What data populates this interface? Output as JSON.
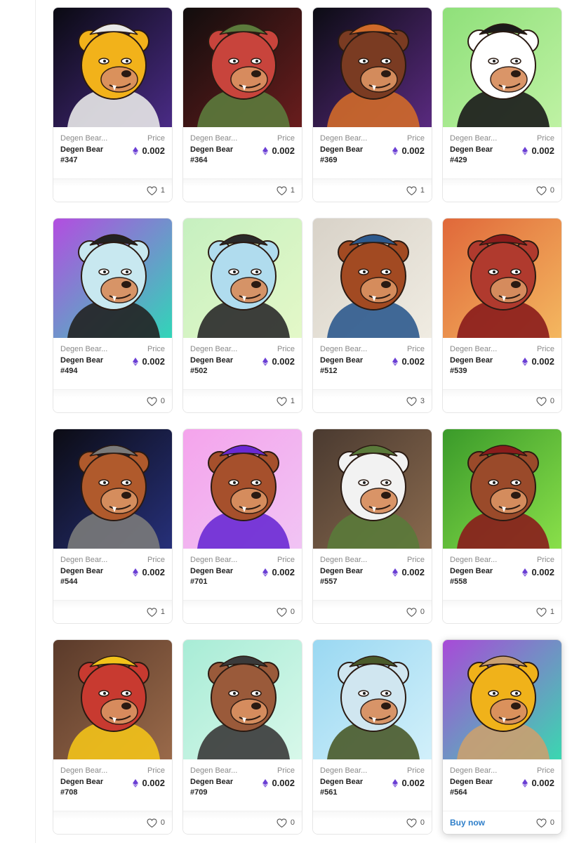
{
  "labels": {
    "price": "Price",
    "buy_now": "Buy now"
  },
  "colors": {
    "eth": "#6b3fd4",
    "link": "#2d7ec9"
  },
  "cards": [
    {
      "collection": "Degen Bear...",
      "name": "Degen Bear",
      "number": "#347",
      "price": "0.002",
      "likes": "1",
      "bg": [
        "#0a0a12",
        "#4a2b86"
      ],
      "fur": "#f2b21a",
      "accent": "#e8e8e8"
    },
    {
      "collection": "Degen Bear...",
      "name": "Degen Bear",
      "number": "#364",
      "price": "0.002",
      "likes": "1",
      "bg": [
        "#110d0d",
        "#6a1d1d"
      ],
      "fur": "#c8443c",
      "accent": "#5c7a3c"
    },
    {
      "collection": "Degen Bear...",
      "name": "Degen Bear",
      "number": "#369",
      "price": "0.002",
      "likes": "1",
      "bg": [
        "#0c0c14",
        "#5a2a80"
      ],
      "fur": "#7a3b22",
      "accent": "#d06a2a"
    },
    {
      "collection": "Degen Bear...",
      "name": "Degen Bear",
      "number": "#429",
      "price": "0.002",
      "likes": "0",
      "bg": [
        "#8fe07a",
        "#bff2a4"
      ],
      "fur": "#ffffff",
      "accent": "#1a1a1a"
    },
    {
      "collection": "Degen Bear...",
      "name": "Degen Bear",
      "number": "#494",
      "price": "0.002",
      "likes": "0",
      "bg": [
        "#b34de0",
        "#30d6b8"
      ],
      "fur": "#c8e8f0",
      "accent": "#222222"
    },
    {
      "collection": "Degen Bear...",
      "name": "Degen Bear",
      "number": "#502",
      "price": "0.002",
      "likes": "1",
      "bg": [
        "#c6f0c0",
        "#e4f8c8"
      ],
      "fur": "#b0dcee",
      "accent": "#2a2a2a"
    },
    {
      "collection": "Degen Bear...",
      "name": "Degen Bear",
      "number": "#512",
      "price": "0.002",
      "likes": "3",
      "bg": [
        "#d8d2c8",
        "#f0ece2"
      ],
      "fur": "#a24a22",
      "accent": "#2d5a8e"
    },
    {
      "collection": "Degen Bear...",
      "name": "Degen Bear",
      "number": "#539",
      "price": "0.002",
      "likes": "0",
      "bg": [
        "#e0683a",
        "#f4b860"
      ],
      "fur": "#b03a2e",
      "accent": "#8a1c1c"
    },
    {
      "collection": "Degen Bear...",
      "name": "Degen Bear",
      "number": "#544",
      "price": "0.002",
      "likes": "1",
      "bg": [
        "#0c0c14",
        "#26307a"
      ],
      "fur": "#b05a2c",
      "accent": "#7a7a7a"
    },
    {
      "collection": "Degen Bear...",
      "name": "Degen Bear",
      "number": "#701",
      "price": "0.002",
      "likes": "0",
      "bg": [
        "#f4a4ec",
        "#f1c4f4"
      ],
      "fur": "#a6502c",
      "accent": "#6a2ad4"
    },
    {
      "collection": "Degen Bear...",
      "name": "Degen Bear",
      "number": "#557",
      "price": "0.002",
      "likes": "0",
      "bg": [
        "#4a3a30",
        "#8a6a4e"
      ],
      "fur": "#f2f2f2",
      "accent": "#5a7a3a"
    },
    {
      "collection": "Degen Bear...",
      "name": "Degen Bear",
      "number": "#558",
      "price": "0.002",
      "likes": "1",
      "bg": [
        "#3a9a2a",
        "#8ae04a"
      ],
      "fur": "#9a4a2a",
      "accent": "#8a1c1c"
    },
    {
      "collection": "Degen Bear...",
      "name": "Degen Bear",
      "number": "#708",
      "price": "0.002",
      "likes": "0",
      "bg": [
        "#5a3a2a",
        "#9a6a4a"
      ],
      "fur": "#c83a30",
      "accent": "#f2c21a"
    },
    {
      "collection": "Degen Bear...",
      "name": "Degen Bear",
      "number": "#709",
      "price": "0.002",
      "likes": "0",
      "bg": [
        "#a8ecd6",
        "#d8f8ea"
      ],
      "fur": "#9a5a3a",
      "accent": "#3a3a3a"
    },
    {
      "collection": "Degen Bear...",
      "name": "Degen Bear",
      "number": "#561",
      "price": "0.002",
      "likes": "0",
      "bg": [
        "#9ad8f2",
        "#d2f0fa"
      ],
      "fur": "#d0e6f0",
      "accent": "#4a5a2a"
    },
    {
      "collection": "Degen Bear...",
      "name": "Degen Bear",
      "number": "#564",
      "price": "0.002",
      "likes": "0",
      "bg": [
        "#a84ad8",
        "#3ad8b0"
      ],
      "fur": "#f0b21a",
      "accent": "#caa070",
      "hovered": true
    }
  ]
}
